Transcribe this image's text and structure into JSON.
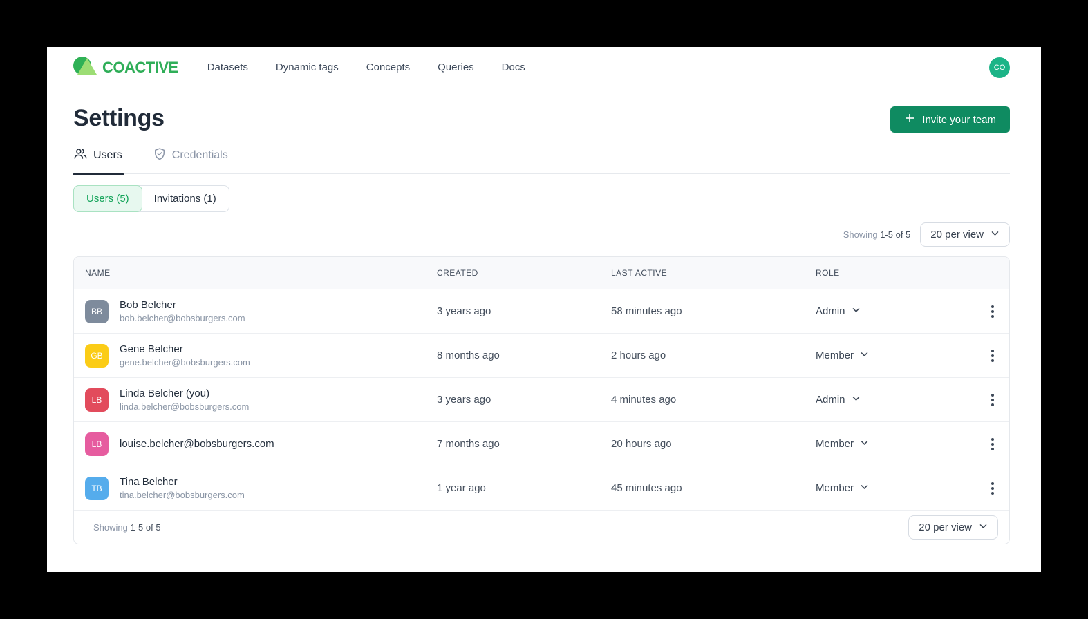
{
  "brand": {
    "name": "COACTIVE"
  },
  "nav": {
    "items": [
      "Datasets",
      "Dynamic tags",
      "Concepts",
      "Queries",
      "Docs"
    ],
    "avatar_initials": "CO"
  },
  "page": {
    "title": "Settings",
    "invite_button_label": "Invite your team"
  },
  "tabs": [
    {
      "label": "Users",
      "icon": "users-icon"
    },
    {
      "label": "Credentials",
      "icon": "shield-check-icon"
    }
  ],
  "filters": [
    {
      "label": "Users (5)"
    },
    {
      "label": "Invitations (1)"
    }
  ],
  "pagination": {
    "showing_label": "Showing",
    "showing_range": "1-5 of 5",
    "per_view": "20 per view"
  },
  "table": {
    "columns": [
      "NAME",
      "CREATED",
      "LAST ACTIVE",
      "ROLE"
    ],
    "rows": [
      {
        "initials": "BB",
        "avatar_color": "#7E8B9C",
        "name": "Bob Belcher",
        "email": "bob.belcher@bobsburgers.com",
        "created": "3 years ago",
        "last_active": "58 minutes ago",
        "role": "Admin"
      },
      {
        "initials": "GB",
        "avatar_color": "#FBCC16",
        "name": "Gene Belcher",
        "email": "gene.belcher@bobsburgers.com",
        "created": "8 months ago",
        "last_active": "2 hours ago",
        "role": "Member"
      },
      {
        "initials": "LB",
        "avatar_color": "#E24B5C",
        "name": "Linda Belcher (you)",
        "email": "linda.belcher@bobsburgers.com",
        "created": "3 years ago",
        "last_active": "4 minutes ago",
        "role": "Admin"
      },
      {
        "initials": "LB",
        "avatar_color": "#E65C9F",
        "name": "louise.belcher@bobsburgers.com",
        "email": "",
        "created": "7 months ago",
        "last_active": "20 hours ago",
        "role": "Member"
      },
      {
        "initials": "TB",
        "avatar_color": "#55ACEC",
        "name": "Tina Belcher",
        "email": "tina.belcher@bobsburgers.com",
        "created": "1 year ago",
        "last_active": "45 minutes ago",
        "role": "Member"
      }
    ]
  },
  "colors": {
    "brand_green": "#2FAE58",
    "brand_light_green": "#9CDD74",
    "invite_button_green": "#0F8B61",
    "profile_avatar_green": "#1CB487",
    "active_filter_bg": "#E7F8EF",
    "active_filter_text": "#14A45A"
  }
}
